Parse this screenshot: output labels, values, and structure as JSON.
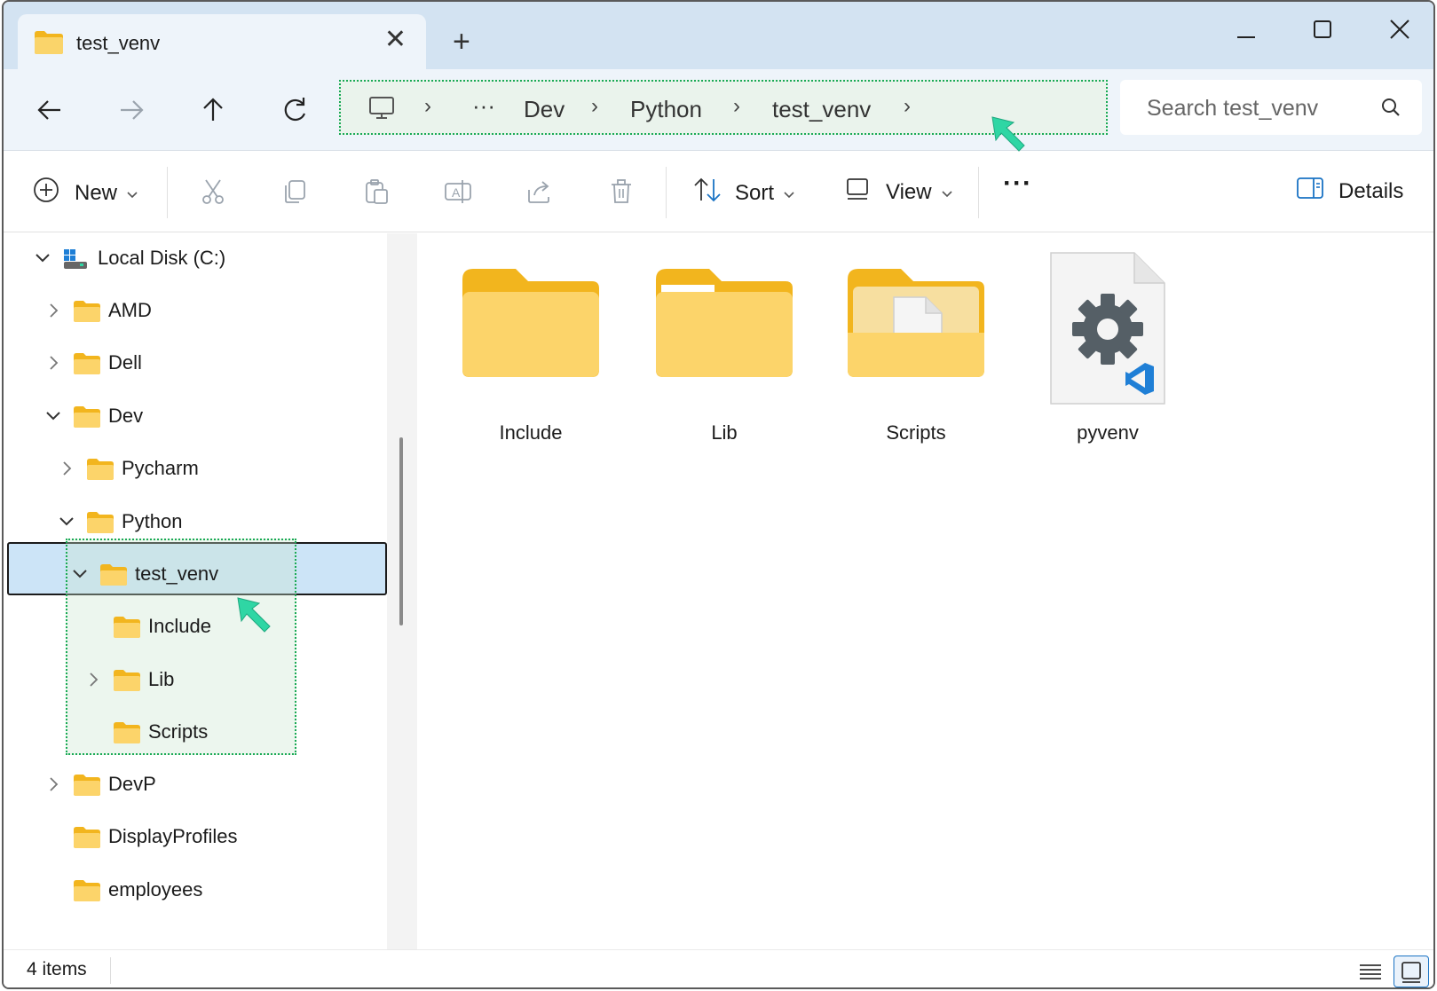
{
  "window": {
    "tab_title": "test_venv",
    "close_tab_glyph": "✕",
    "new_tab_glyph": "+"
  },
  "address_bar": {
    "ellipsis": "···",
    "crumbs": [
      "Dev",
      "Python",
      "test_venv"
    ],
    "separator": "›"
  },
  "search": {
    "placeholder": "Search test_venv"
  },
  "toolbar": {
    "new_label": "New",
    "sort_label": "Sort",
    "view_label": "View",
    "more_glyph": "···",
    "details_label": "Details"
  },
  "sidebar": {
    "items": [
      {
        "label": "Local Disk (C:)",
        "chevron": "down"
      },
      {
        "label": "AMD",
        "chevron": "right"
      },
      {
        "label": "Dell",
        "chevron": "right"
      },
      {
        "label": "Dev",
        "chevron": "down"
      },
      {
        "label": "Pycharm",
        "chevron": "right"
      },
      {
        "label": "Python",
        "chevron": "down"
      },
      {
        "label": "test_venv",
        "chevron": "down",
        "selected": true
      },
      {
        "label": "Include",
        "chevron": "none"
      },
      {
        "label": "Lib",
        "chevron": "right"
      },
      {
        "label": "Scripts",
        "chevron": "none"
      },
      {
        "label": "DevP",
        "chevron": "right"
      },
      {
        "label": "DisplayProfiles",
        "chevron": "none"
      },
      {
        "label": "employees",
        "chevron": "none"
      }
    ]
  },
  "content": {
    "items": [
      {
        "label": "Include",
        "icon": "folder-icon"
      },
      {
        "label": "Lib",
        "icon": "folder-icon"
      },
      {
        "label": "Scripts",
        "icon": "folder-with-file-icon"
      },
      {
        "label": "pyvenv",
        "icon": "config-file-icon"
      }
    ]
  },
  "status": {
    "item_count": "4 items"
  },
  "colors": {
    "accent_highlight": "#1aaa55",
    "selection": "#cce4f7",
    "folder": "#f7c948",
    "cursor": "#2fd6a4"
  }
}
